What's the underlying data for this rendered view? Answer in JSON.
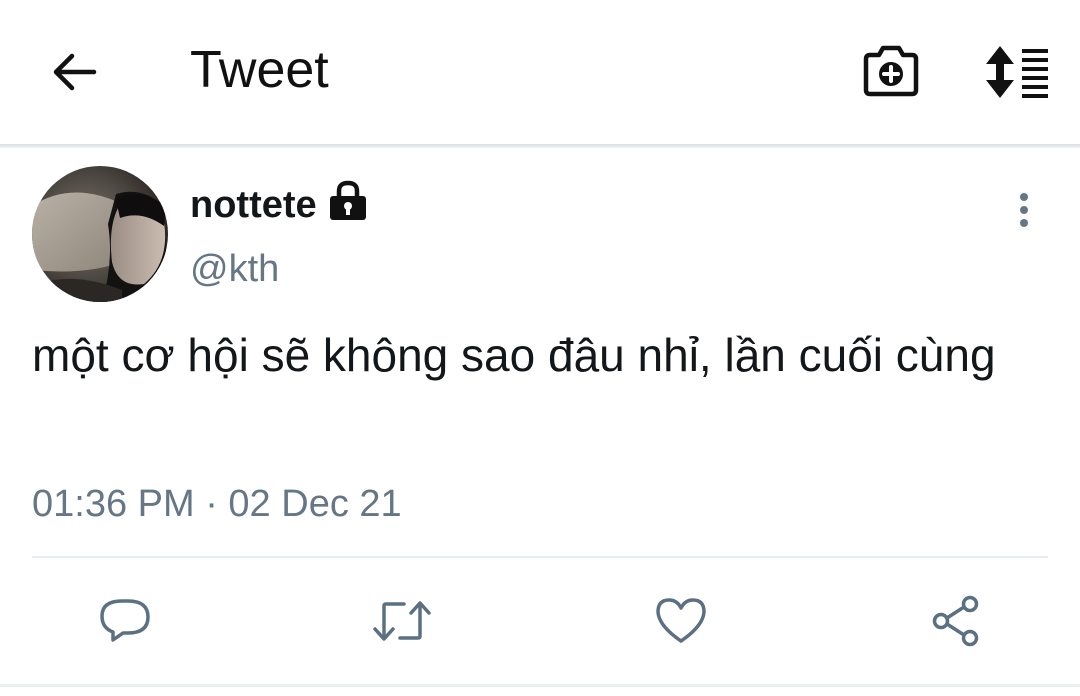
{
  "header": {
    "title": "Tweet",
    "icons": [
      "back-arrow-icon",
      "camera-add-icon",
      "sort-list-icon"
    ]
  },
  "tweet": {
    "author": {
      "display_name": "nottete",
      "handle": "@kth",
      "protected_icon": "lock-icon"
    },
    "text": "một cơ hội sẽ không sao đâu nhỉ, lần cuối cùng",
    "timestamp": "01:36 PM · 02 Dec 21",
    "actions": [
      "reply-icon",
      "retweet-icon",
      "like-icon",
      "share-icon"
    ]
  },
  "colors": {
    "primary_text": "#14171a",
    "secondary_text": "#657786",
    "action_icon": "#5b7083",
    "divider": "#e6ecf0"
  }
}
